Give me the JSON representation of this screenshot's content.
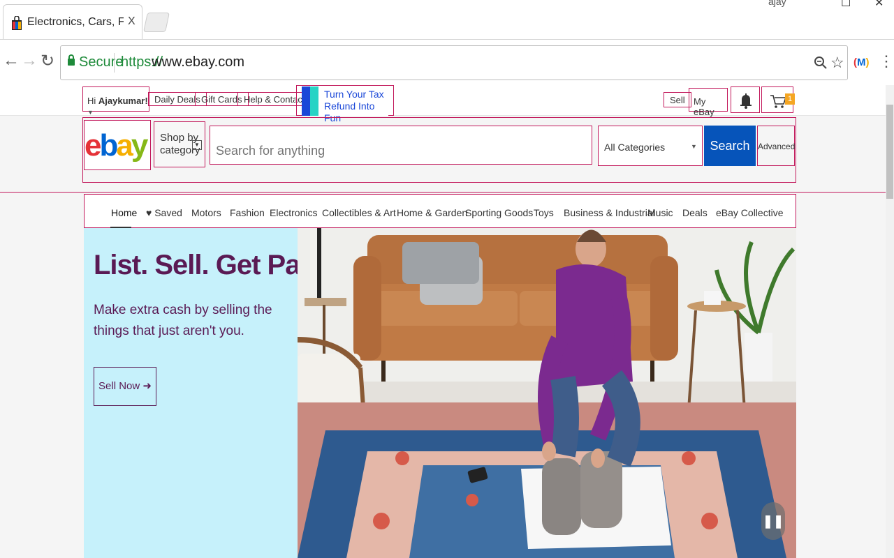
{
  "browser": {
    "tab_title": "Electronics, Cars, Fashion",
    "tab_close": "X",
    "profile": "ajay",
    "secure_label": "Secure",
    "url_scheme": "https://",
    "url_host": "www.ebay.com"
  },
  "header": {
    "greeting_prefix": "Hi ",
    "user_name": "Ajaykumar!",
    "links": [
      "Daily Deals",
      "Gift Cards",
      "Help & Contact"
    ],
    "promo_line1": "Turn Your Tax",
    "promo_line2": "Refund Into Fun",
    "sell": "Sell",
    "my_ebay": "My eBay",
    "cart_count": "1"
  },
  "search": {
    "shop_by_line1": "Shop by",
    "shop_by_line2": "category",
    "placeholder": "Search for anything",
    "category": "All Categories",
    "button": "Search",
    "advanced": "Advanced"
  },
  "nav": {
    "items": [
      "Home",
      "Saved",
      "Motors",
      "Fashion",
      "Electronics",
      "Collectibles & Art",
      "Home & Garden",
      "Sporting Goods",
      "Toys",
      "Business & Industrial",
      "Music",
      "Deals",
      "eBay Collective"
    ]
  },
  "hero": {
    "title": "List. Sell. Get Paid.",
    "subtitle": "Make extra cash by selling the things that just aren't you.",
    "cta": "Sell Now"
  },
  "colors": {
    "brand_blue": "#0654ba",
    "hero_text": "#5a1a54",
    "hero_bg": "#c6f1fb",
    "outline": "#c2185b"
  }
}
